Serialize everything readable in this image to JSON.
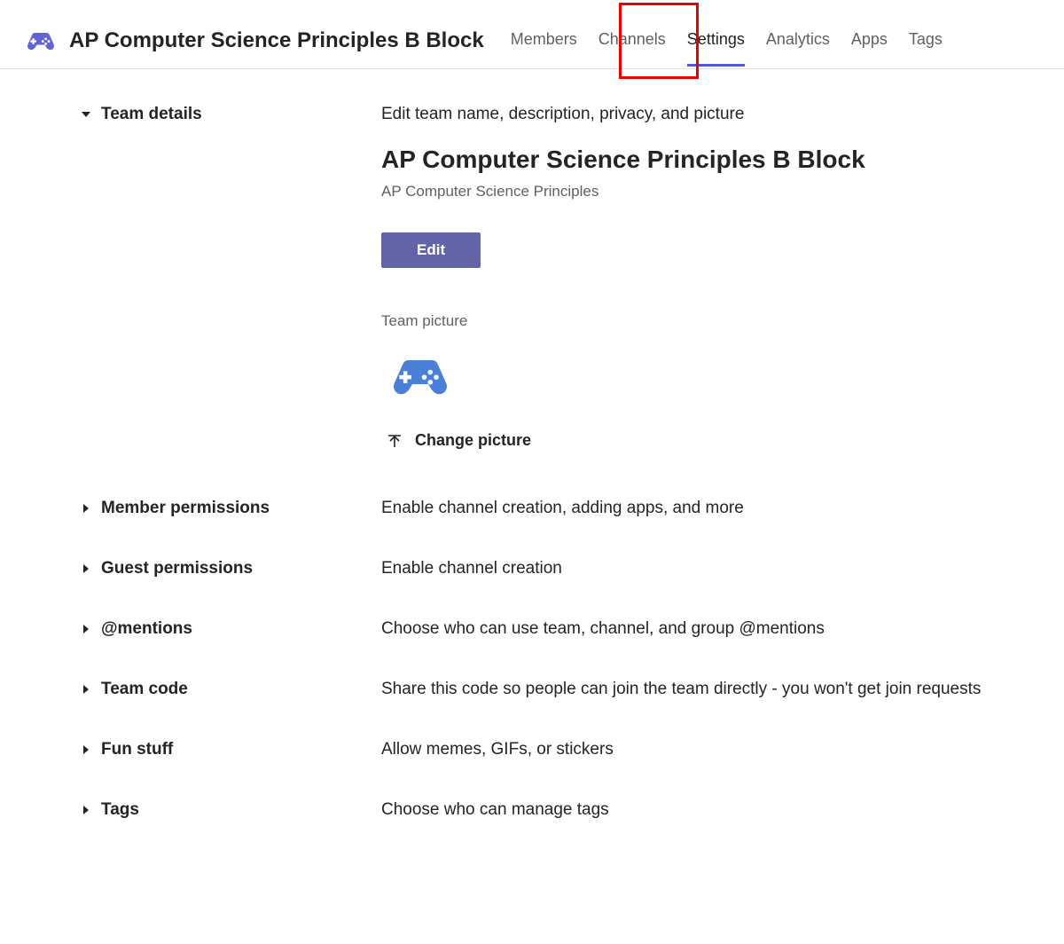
{
  "header": {
    "title": "AP Computer Science Principles B Block",
    "tabs": [
      {
        "label": "Members"
      },
      {
        "label": "Channels"
      },
      {
        "label": "Settings"
      },
      {
        "label": "Analytics"
      },
      {
        "label": "Apps"
      },
      {
        "label": "Tags"
      }
    ]
  },
  "details": {
    "section_label": "Team details",
    "description": "Edit team name, description, privacy, and picture",
    "team_name": "AP Computer Science Principles B Block",
    "team_sub": "AP Computer Science Principles",
    "edit_label": "Edit",
    "picture_label": "Team picture",
    "change_picture_label": "Change picture"
  },
  "sections": [
    {
      "title": "Member permissions",
      "desc": "Enable channel creation, adding apps, and more"
    },
    {
      "title": "Guest permissions",
      "desc": "Enable channel creation"
    },
    {
      "title": "@mentions",
      "desc": "Choose who can use team, channel, and group @mentions"
    },
    {
      "title": "Team code",
      "desc": "Share this code so people can join the team directly - you won't get join requests"
    },
    {
      "title": "Fun stuff",
      "desc": "Allow memes, GIFs, or stickers"
    },
    {
      "title": "Tags",
      "desc": "Choose who can manage tags"
    }
  ]
}
